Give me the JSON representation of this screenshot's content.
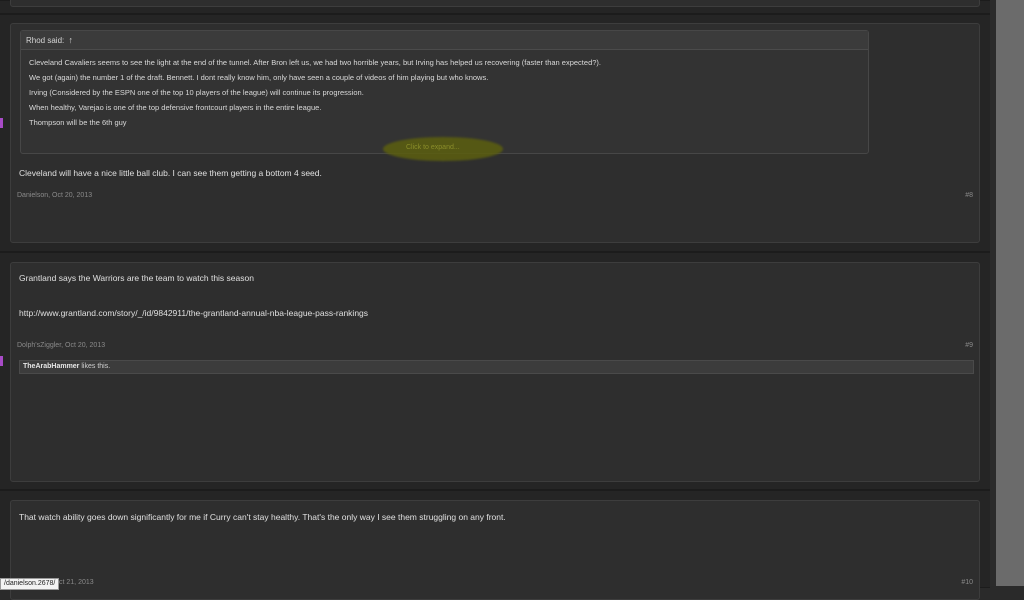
{
  "post8": {
    "quote_author": "Rhod said:",
    "quote_arrow": "↑",
    "quote_lines": [
      "Cleveland Cavaliers seems to see the light at the end of the tunnel. After Bron left us, we had two horrible years, but Irving has helped us recovering (faster than expected?).",
      "We got (again) the number 1 of the draft. Bennett. I dont really know him, only have seen a couple of videos of him playing but who knows.",
      "Irving (Considered by the ESPN one of the top 10 players of the league) will continue its progression.",
      "When healthy, Varejao is one of the top defensive frontcourt players in the entire league.",
      "Thompson will be the 6th guy"
    ],
    "expand_label": "Click to expand...",
    "body": "Cleveland will have a nice little ball club. I can see them getting a bottom 4 seed.",
    "meta": "Danielson, Oct 20, 2013",
    "number": "#8"
  },
  "post9": {
    "line1": "Grantland says the Warriors are the team to watch this season",
    "line2": "http://www.grantland.com/story/_/id/9842911/the-grantland-annual-nba-league-pass-rankings",
    "meta": "Dolph'sZiggler, Oct 20, 2013",
    "number": "#9",
    "likes_user": "TheArabHammer",
    "likes_suffix": " likes this."
  },
  "post10": {
    "body": "That watch ability goes down significantly for me if Curry can't stay healthy. That's the only way I see them struggling on any front.",
    "meta": "ct 21, 2013",
    "number": "#10"
  },
  "status_bar": {
    "url": "/danielson.2678/"
  }
}
